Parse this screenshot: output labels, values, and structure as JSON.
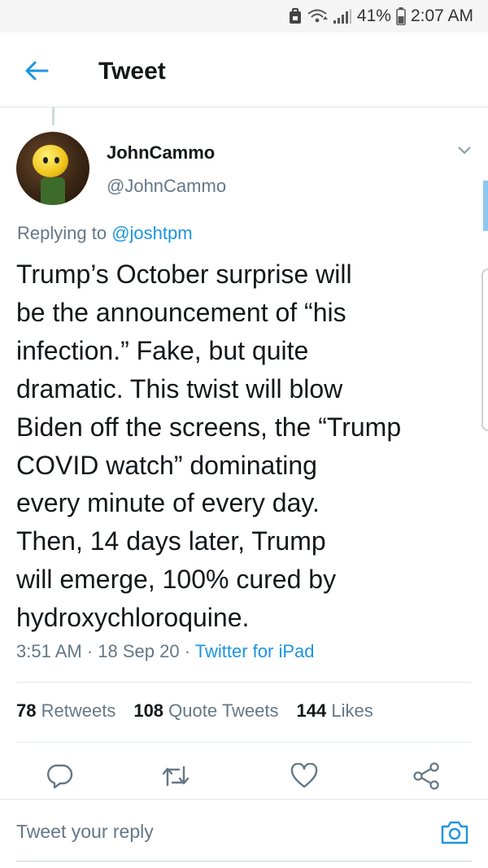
{
  "status_bar": {
    "battery": "41%",
    "time": "2:07 AM",
    "icons": [
      "notification-icon",
      "wifi-icon",
      "signal-icon",
      "battery-icon"
    ]
  },
  "app_bar": {
    "title": "Tweet",
    "back_icon": "arrow-left-icon"
  },
  "tweet": {
    "author": {
      "display_name": "JohnCammo",
      "handle": "@JohnCammo"
    },
    "replying_prefix": "Replying to",
    "replying_to": "@joshtpm",
    "text_lines": [
      "Trump’s October surprise will",
      "be the announcement of “his",
      "infection.”  Fake, but quite",
      "dramatic. This twist will blow",
      "Biden off the screens, the “Trump",
      "COVID watch” dominating",
      "every minute of every day.",
      "Then, 14 days later, Trump",
      "will emerge, 100% cured by",
      "hydroxychloroquine."
    ],
    "time": "3:51 AM",
    "date": "18 Sep 20",
    "separator": "·",
    "source": "Twitter for iPad"
  },
  "stats": {
    "retweets": {
      "count": "78",
      "label": "Retweets"
    },
    "quote_tweets": {
      "count": "108",
      "label": "Quote Tweets"
    },
    "likes": {
      "count": "144",
      "label": "Likes"
    }
  },
  "actions": [
    "reply-icon",
    "retweet-icon",
    "like-icon",
    "share-icon"
  ],
  "reply_bar": {
    "placeholder": "Tweet your reply",
    "camera_icon": "camera-icon"
  },
  "colors": {
    "accent": "#1b95e0",
    "secondary_text": "#657786",
    "primary_text": "#14171a"
  }
}
